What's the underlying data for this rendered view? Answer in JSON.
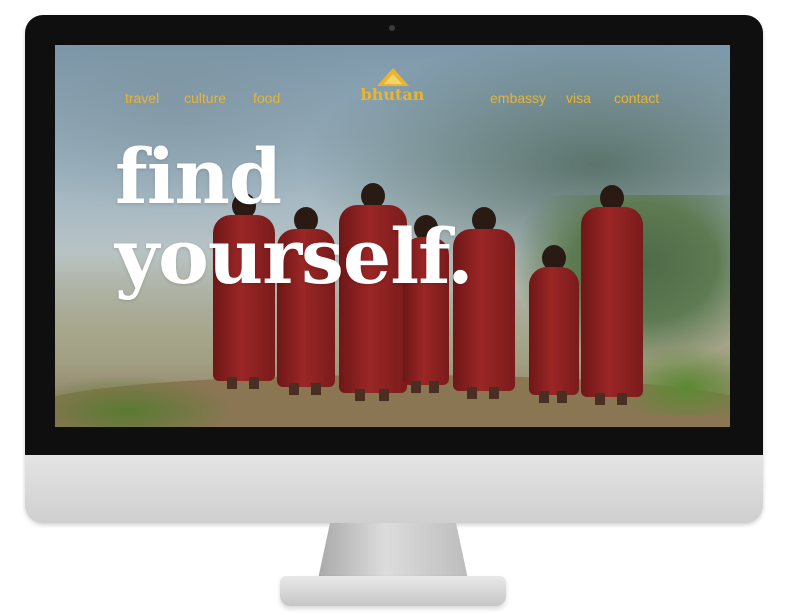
{
  "site": {
    "brand": "bhutan",
    "nav_left": [
      {
        "label": "travel"
      },
      {
        "label": "culture"
      },
      {
        "label": "food"
      }
    ],
    "nav_right": [
      {
        "label": "embassy"
      },
      {
        "label": "visa"
      },
      {
        "label": "contact"
      }
    ],
    "headline_line1": "find",
    "headline_line2": "yourself."
  },
  "colors": {
    "accent": "#e9b531",
    "headline": "#ffffff",
    "robe": "#9b2626"
  },
  "icons": {
    "brand_logo": "triangle-logo-icon"
  }
}
